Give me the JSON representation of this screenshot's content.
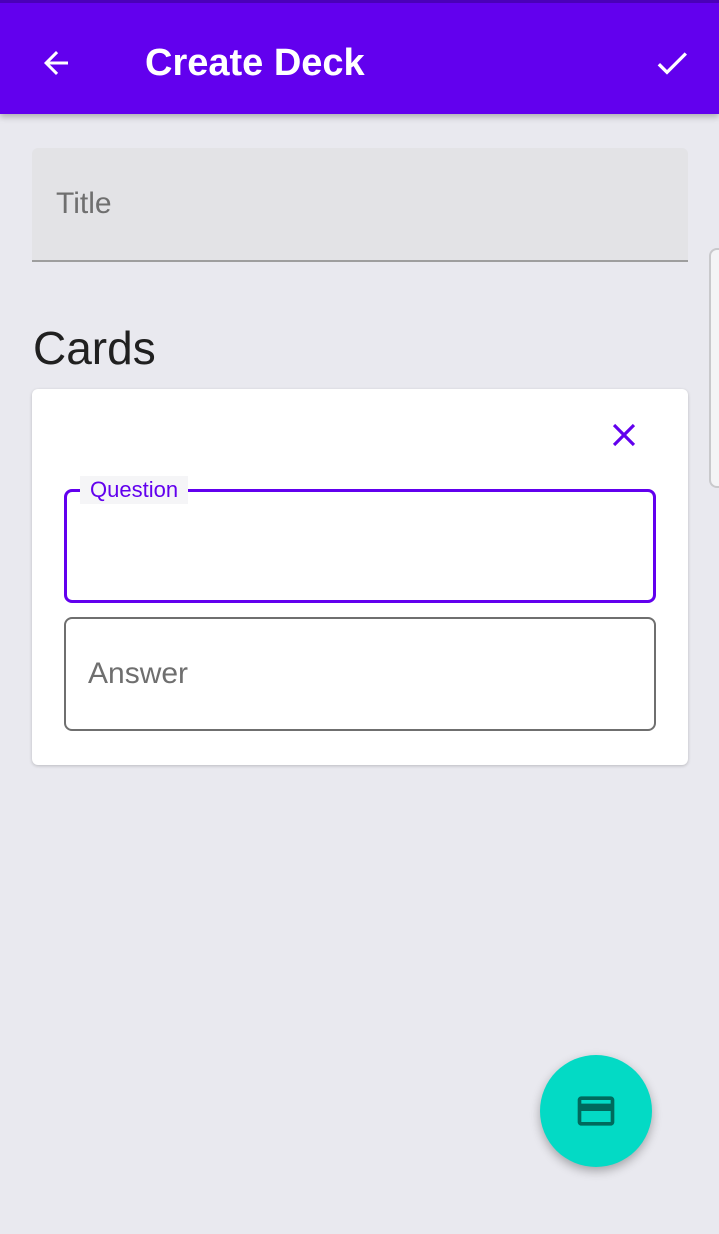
{
  "app_bar": {
    "title": "Create Deck",
    "back_icon": "arrow-back-icon",
    "confirm_icon": "check-icon",
    "color": "#6200ee"
  },
  "title_field": {
    "placeholder": "Title",
    "value": ""
  },
  "cards_section": {
    "heading": "Cards"
  },
  "card_editor": {
    "remove_icon": "close-icon",
    "question": {
      "label": "Question",
      "value": ""
    },
    "answer": {
      "placeholder": "Answer",
      "value": ""
    }
  },
  "fab": {
    "icon": "card-icon",
    "color": "#03dac5"
  },
  "colors": {
    "accent": "#6200ee",
    "secondary": "#03dac5",
    "background": "#e9e9ef"
  }
}
